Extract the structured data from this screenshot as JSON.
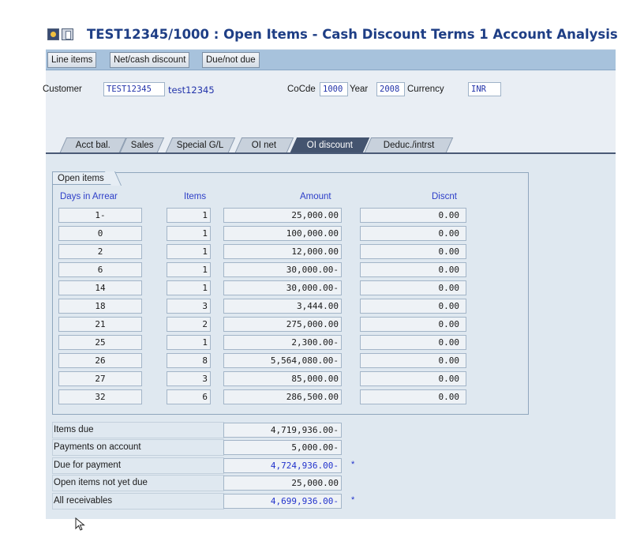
{
  "window": {
    "title": "TEST12345/1000 : Open Items - Cash Discount Terms 1 Account Analysis",
    "icons": [
      "execute-icon",
      "document-icon"
    ]
  },
  "toolbar": {
    "buttons": [
      "Line items",
      "Net/cash discount",
      "Due/not due"
    ]
  },
  "header": {
    "customer_label": "Customer",
    "customer_value": "TEST12345",
    "customer_name": "test12345",
    "cocode_label": "CoCde",
    "cocode_value": "1000",
    "year_label": "Year",
    "year_value": "2008",
    "currency_label": "Currency",
    "currency_value": "INR"
  },
  "tabs": {
    "labels": [
      "Acct bal.",
      "Sales",
      "Special G/L",
      "OI net",
      "OI discount",
      "Deduc./intrst"
    ],
    "active": "OI discount"
  },
  "open_items": {
    "group_title": "Open items",
    "headers": {
      "days": "Days in Arrear",
      "items": "Items",
      "amount": "Amount",
      "discount": "Discnt"
    },
    "rows": [
      {
        "days": "1-",
        "items": "1",
        "amount": "25,000.00",
        "discount": "0.00"
      },
      {
        "days": "0",
        "items": "1",
        "amount": "100,000.00",
        "discount": "0.00"
      },
      {
        "days": "2",
        "items": "1",
        "amount": "12,000.00",
        "discount": "0.00"
      },
      {
        "days": "6",
        "items": "1",
        "amount": "30,000.00-",
        "discount": "0.00"
      },
      {
        "days": "14",
        "items": "1",
        "amount": "30,000.00-",
        "discount": "0.00"
      },
      {
        "days": "18",
        "items": "3",
        "amount": "3,444.00",
        "discount": "0.00"
      },
      {
        "days": "21",
        "items": "2",
        "amount": "275,000.00",
        "discount": "0.00"
      },
      {
        "days": "25",
        "items": "1",
        "amount": "2,300.00-",
        "discount": "0.00"
      },
      {
        "days": "26",
        "items": "8",
        "amount": "5,564,080.00-",
        "discount": "0.00"
      },
      {
        "days": "27",
        "items": "3",
        "amount": "85,000.00",
        "discount": "0.00"
      },
      {
        "days": "32",
        "items": "6",
        "amount": "286,500.00",
        "discount": "0.00"
      }
    ]
  },
  "summary": {
    "rows": [
      {
        "label": "Items due",
        "value": "4,719,936.00-",
        "highlight": false,
        "mark": ""
      },
      {
        "label": "Payments on account",
        "value": "5,000.00-",
        "highlight": false,
        "mark": ""
      },
      {
        "label": "Due for payment",
        "value": "4,724,936.00-",
        "highlight": true,
        "mark": "*"
      },
      {
        "label": "Open items not yet due",
        "value": "25,000.00",
        "highlight": false,
        "mark": ""
      },
      {
        "label": "All receivables",
        "value": "4,699,936.00-",
        "highlight": true,
        "mark": "*"
      }
    ]
  },
  "colors": {
    "title_text": "#1e3e85",
    "toolbar_bg": "#a7c2dc",
    "content_bg": "#dfe8f0",
    "active_tab": "#44546f",
    "value_blue": "#2233cc"
  }
}
